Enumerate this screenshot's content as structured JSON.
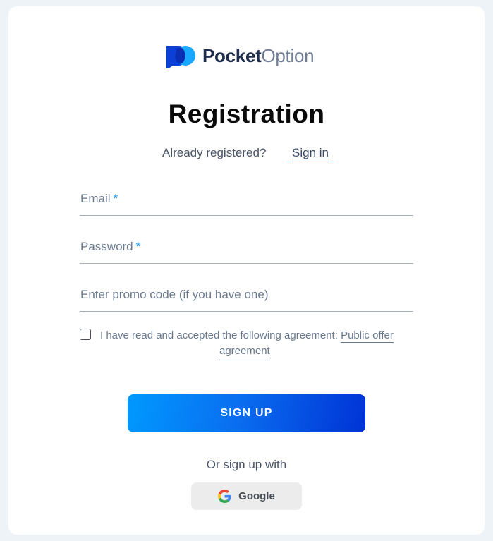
{
  "logo": {
    "name_bold": "Pocket",
    "name_light": "Option",
    "icon": "pocket-option-logo-icon",
    "colors": {
      "dark_blue": "#0b3fd6",
      "light_blue": "#1aa7ff"
    }
  },
  "page": {
    "title": "Registration",
    "already_registered": "Already registered?",
    "sign_in_link": "Sign in"
  },
  "form": {
    "email": {
      "label": "Email",
      "required_mark": "*"
    },
    "password": {
      "label": "Password",
      "required_mark": "*"
    },
    "promo": {
      "label": "Enter promo code (if you have one)"
    },
    "agreement": {
      "checked": false,
      "text": "I have read and accepted the following agreement:",
      "link_part1": "Public offer",
      "link_part2": "agreement"
    },
    "submit_label": "SIGN UP"
  },
  "social": {
    "or_text": "Or sign up with",
    "google_label": "Google",
    "google_icon": "google-icon"
  },
  "colors": {
    "background": "#eef3f8",
    "card": "#ffffff",
    "accent": "#1a8fe0",
    "button_gradient_start": "#0099ff",
    "button_gradient_end": "#0033d6"
  }
}
